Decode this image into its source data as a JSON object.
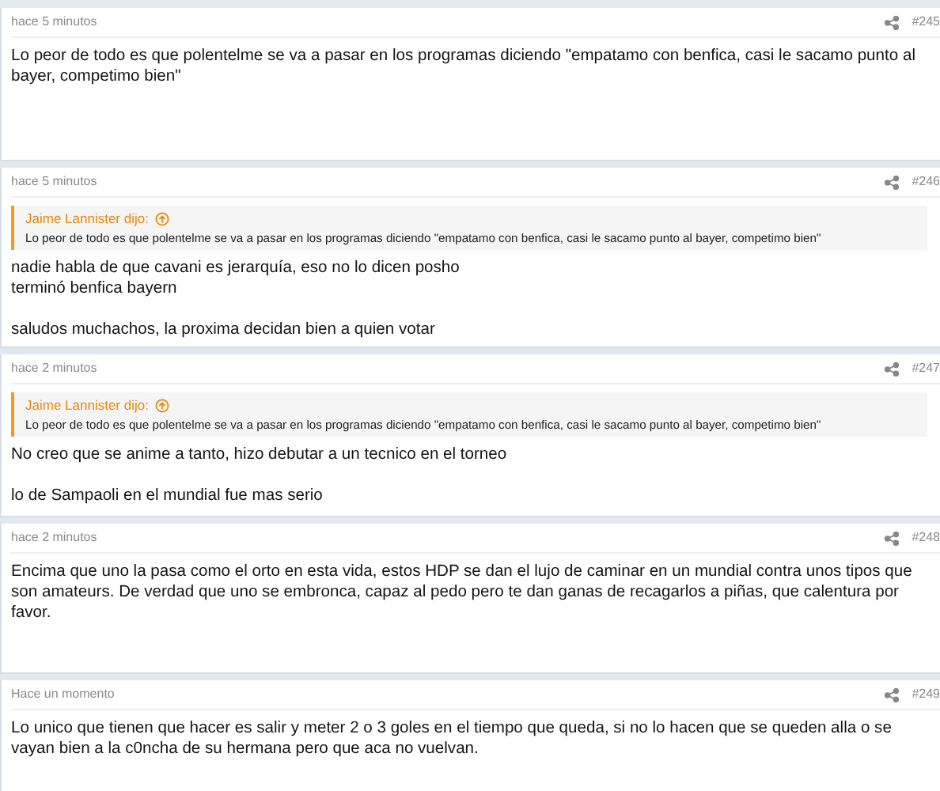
{
  "posts": [
    {
      "time": "hace 5 minutos",
      "number": "#245",
      "paragraphs": [
        "Lo peor de todo es que polentelme se va a pasar en los programas diciendo \"empatamo con benfica, casi le sacamo punto al bayer, competimo bien\""
      ]
    },
    {
      "time": "hace 5 minutos",
      "number": "#246",
      "quote": {
        "author": "Jaime Lannister dijo:",
        "text": "Lo peor de todo es que polentelme se va a pasar en los programas diciendo \"empatamo con benfica, casi le sacamo punto al bayer, competimo bien\""
      },
      "paragraphs": [
        "nadie habla de que cavani es jerarquía, eso no lo dicen posho\nterminó benfica bayern",
        "saludos muchachos, la proxima decidan bien a quien votar"
      ]
    },
    {
      "time": "hace 2 minutos",
      "number": "#247",
      "quote": {
        "author": "Jaime Lannister dijo:",
        "text": "Lo peor de todo es que polentelme se va a pasar en los programas diciendo \"empatamo con benfica, casi le sacamo punto al bayer, competimo bien\""
      },
      "paragraphs": [
        "No creo que se anime a tanto, hizo debutar a un tecnico en el torneo",
        "lo de Sampaoli en el mundial fue mas serio"
      ]
    },
    {
      "time": "hace 2 minutos",
      "number": "#248",
      "paragraphs": [
        "Encima que uno la pasa como el orto en esta vida, estos HDP se dan el lujo de caminar en un mundial contra unos tipos que son amateurs. De verdad que uno se embronca, capaz al pedo pero te dan ganas de recagarlos a piñas, que calentura por favor."
      ]
    },
    {
      "time": "Hace un momento",
      "number": "#249",
      "paragraphs": [
        "Lo unico que tienen que hacer es salir y meter 2 o 3 goles en el tiempo que queda, si no lo hacen que se queden alla o se vayan bien a la c0ncha de su hermana pero que aca no vuelvan."
      ]
    }
  ]
}
